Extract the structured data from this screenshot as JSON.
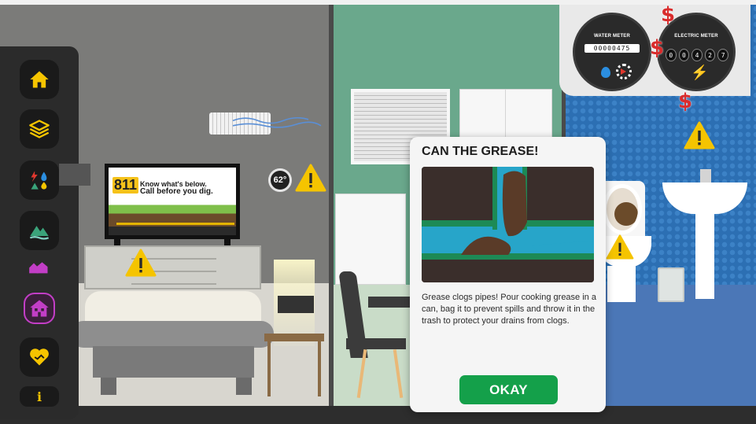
{
  "sidebar": {
    "items": [
      {
        "name": "home",
        "icon": "home-icon"
      },
      {
        "name": "layers",
        "icon": "layers-icon"
      },
      {
        "name": "utilities",
        "icon": "utilities-icon"
      },
      {
        "name": "environment",
        "icon": "mountain-icon"
      },
      {
        "name": "community",
        "icon": "houses-icon"
      },
      {
        "name": "house",
        "icon": "house-icon",
        "active": true
      },
      {
        "name": "partnership",
        "icon": "handshake-icon"
      }
    ],
    "info_label": "i",
    "accent": "#f5c400",
    "active_color": "#c23ec6"
  },
  "tv": {
    "logo": "811",
    "line1": "Know what's below.",
    "line2": "Call before you dig."
  },
  "thermostat": {
    "reading": "62°"
  },
  "meters": {
    "water": {
      "title": "WATER METER",
      "reading": "00000475"
    },
    "electric": {
      "title": "ELECTRIC METER",
      "digits": [
        "0",
        "0",
        "4",
        "2",
        "7"
      ]
    },
    "currency_symbol": "$"
  },
  "modal": {
    "title": "CAN THE GREASE!",
    "body": "Grease clogs pipes! Pour cooking grease in a can, bag it to prevent spills and throw it in the trash to protect your drains from clogs.",
    "button_label": "OKAY",
    "button_color": "#14a04a"
  },
  "colors": {
    "warning": "#f5c400",
    "dollar": "#d92c2c"
  }
}
